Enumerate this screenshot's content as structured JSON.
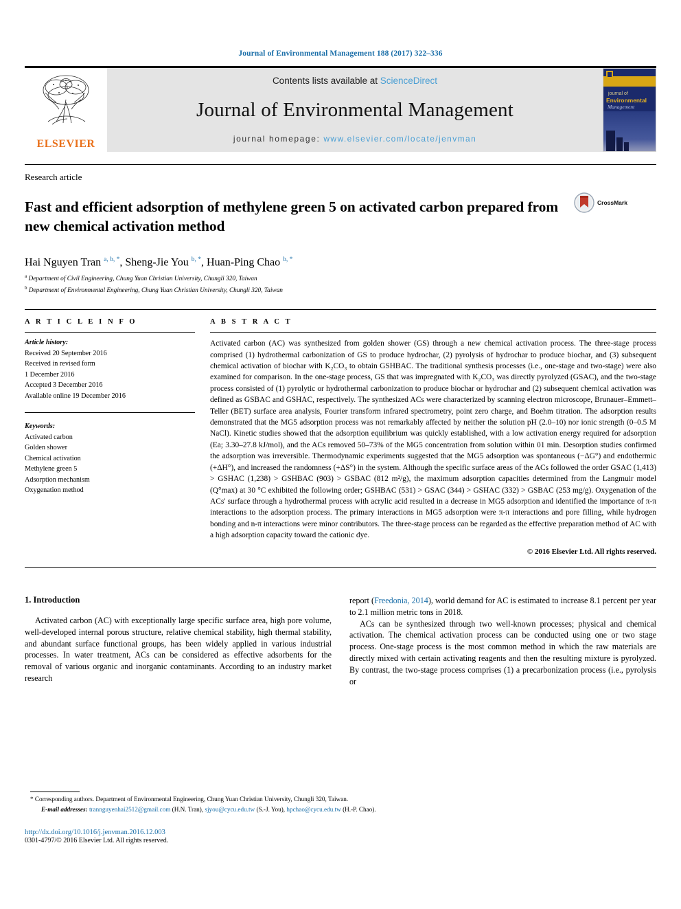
{
  "running_head": "Journal of Environmental Management 188 (2017) 322–336",
  "masthead": {
    "publisher_name": "ELSEVIER",
    "contents_prefix": "Contents lists available at ",
    "contents_link": "ScienceDirect",
    "journal_name": "Journal of Environmental Management",
    "homepage_prefix": "journal homepage: ",
    "homepage_url": "www.elsevier.com/locate/jenvman",
    "cover": {
      "line1": "journal of",
      "line2": "Environmental",
      "line3": "Management"
    }
  },
  "article": {
    "type": "Research article",
    "title": "Fast and efficient adsorption of methylene green 5 on activated carbon prepared from new chemical activation method",
    "crossmark_label": "CrossMark",
    "authors_html": "Hai Nguyen Tran <sup>a, b, *</sup>, Sheng-Jie You <sup>b, *</sup>, Huan-Ping Chao <sup>b, *</sup>",
    "affiliations": [
      {
        "marker": "a",
        "text": "Department of Civil Engineering, Chung Yuan Christian University, Chungli 320, Taiwan"
      },
      {
        "marker": "b",
        "text": "Department of Environmental Engineering, Chung Yuan Christian University, Chungli 320, Taiwan"
      }
    ]
  },
  "article_info": {
    "heading": "A R T I C L E   I N F O",
    "history_label": "Article history:",
    "history": [
      "Received 20 September 2016",
      "Received in revised form",
      "1 December 2016",
      "Accepted 3 December 2016",
      "Available online 19 December 2016"
    ],
    "keywords_label": "Keywords:",
    "keywords": [
      "Activated carbon",
      "Golden shower",
      "Chemical activation",
      "Methylene green 5",
      "Adsorption mechanism",
      "Oxygenation method"
    ]
  },
  "abstract": {
    "heading": "A B S T R A C T",
    "text": "Activated carbon (AC) was synthesized from golden shower (GS) through a new chemical activation process. The three-stage process comprised (1) hydrothermal carbonization of GS to produce hydrochar, (2) pyrolysis of hydrochar to produce biochar, and (3) subsequent chemical activation of biochar with K₂CO₃ to obtain GSHBAC. The traditional synthesis processes (i.e., one-stage and two-stage) were also examined for comparison. In the one-stage process, GS that was impregnated with K₂CO₃ was directly pyrolyzed (GSAC), and the two-stage process consisted of (1) pyrolytic or hydrothermal carbonization to produce biochar or hydrochar and (2) subsequent chemical activation was defined as GSBAC and GSHAC, respectively. The synthesized ACs were characterized by scanning electron microscope, Brunauer–Emmett–Teller (BET) surface area analysis, Fourier transform infrared spectrometry, point zero charge, and Boehm titration. The adsorption results demonstrated that the MG5 adsorption process was not remarkably affected by neither the solution pH (2.0–10) nor ionic strength (0–0.5 M NaCl). Kinetic studies showed that the adsorption equilibrium was quickly established, with a low activation energy required for adsorption (Ea; 3.30–27.8 kJ/mol), and the ACs removed 50–73% of the MG5 concentration from solution within 01 min. Desorption studies confirmed the adsorption was irreversible. Thermodynamic experiments suggested that the MG5 adsorption was spontaneous (−ΔG°) and endothermic (+ΔH°), and increased the randomness (+ΔS°) in the system. Although the specific surface areas of the ACs followed the order GSAC (1,413) > GSHAC (1,238) > GSHBAC (903) > GSBAC (812 m²/g), the maximum adsorption capacities determined from the Langmuir model (Q°max) at 30 °C exhibited the following order; GSHBAC (531) > GSAC (344) > GSHAC (332) > GSBAC (253 mg/g). Oxygenation of the ACs' surface through a hydrothermal process with acrylic acid resulted in a decrease in MG5 adsorption and identified the importance of π-π interactions to the adsorption process. The primary interactions in MG5 adsorption were π-π interactions and pore filling, while hydrogen bonding and n-π interactions were minor contributors. The three-stage process can be regarded as the effective preparation method of AC with a high adsorption capacity toward the cationic dye.",
    "copyright": "© 2016 Elsevier Ltd. All rights reserved."
  },
  "body": {
    "section_number_title": "1. Introduction",
    "left_paragraph": "Activated carbon (AC) with exceptionally large specific surface area, high pore volume, well-developed internal porous structure, relative chemical stability, high thermal stability, and abundant surface functional groups, has been widely applied in various industrial processes. In water treatment, ACs can be considered as effective adsorbents for the removal of various organic and inorganic contaminants. According to an industry market research",
    "right_paragraph_1_pre": "report (",
    "right_paragraph_1_link": "Freedonia, 2014",
    "right_paragraph_1_post": "), world demand for AC is estimated to increase 8.1 percent per year to 2.1 million metric tons in 2018.",
    "right_paragraph_2": "ACs can be synthesized through two well-known processes; physical and chemical activation. The chemical activation process can be conducted using one or two stage process. One-stage process is the most common method in which the raw materials are directly mixed with certain activating reagents and then the resulting mixture is pyrolyzed. By contrast, the two-stage process comprises (1) a precarbonization process (i.e., pyrolysis or"
  },
  "footnotes": {
    "corresponding": "Corresponding authors. Department of Environmental Engineering, Chung Yuan Christian University, Chungli 320, Taiwan.",
    "email_label": "E-mail addresses:",
    "emails": [
      {
        "address": "trannguyenhai2512@gmail.com",
        "owner": "(H.N. Tran)"
      },
      {
        "address": "sjyou@cycu.edu.tw",
        "owner": "(S.-J. You)"
      },
      {
        "address": "hpchao@cycu.edu.tw",
        "owner": "(H.-P. Chao)"
      }
    ],
    "doi": "http://dx.doi.org/10.1016/j.jenvman.2016.12.003",
    "issn": "0301-4797/© 2016 Elsevier Ltd. All rights reserved."
  },
  "colors": {
    "link_blue": "#1a6ea8",
    "sciencedirect_blue": "#4a9fd4",
    "elsevier_orange": "#E9711C",
    "masthead_gray": "#e4e4e4"
  }
}
